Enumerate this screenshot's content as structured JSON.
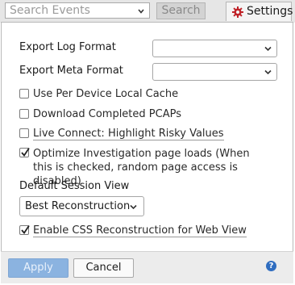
{
  "toolbar": {
    "search_placeholder": "Search Events",
    "search_button": "Search",
    "settings_button": "Settings"
  },
  "settings": {
    "export_log_format_label": "Export Log Format",
    "export_log_format_value": "",
    "export_meta_format_label": "Export Meta Format",
    "export_meta_format_value": "",
    "options": [
      {
        "label": "Use Per Device Local Cache",
        "checked": false
      },
      {
        "label": "Download Completed PCAPs",
        "checked": false
      },
      {
        "label": "Live Connect: Highlight Risky Values",
        "checked": false
      },
      {
        "label": "Optimize Investigation page loads (When this is checked, random page access is disabled)",
        "checked": true
      }
    ],
    "default_session_view_label": "Default Session View",
    "default_session_view_value": "Best Reconstruction",
    "css_reconstruction_label": "Enable CSS Reconstruction for Web View",
    "css_reconstruction_checked": true
  },
  "footer": {
    "apply_label": "Apply",
    "cancel_label": "Cancel",
    "help_symbol": "?"
  },
  "colors": {
    "accent": "#2f6dc0",
    "apply_disabled": "#8bb3e0",
    "settings_gear": "#c0242a"
  }
}
